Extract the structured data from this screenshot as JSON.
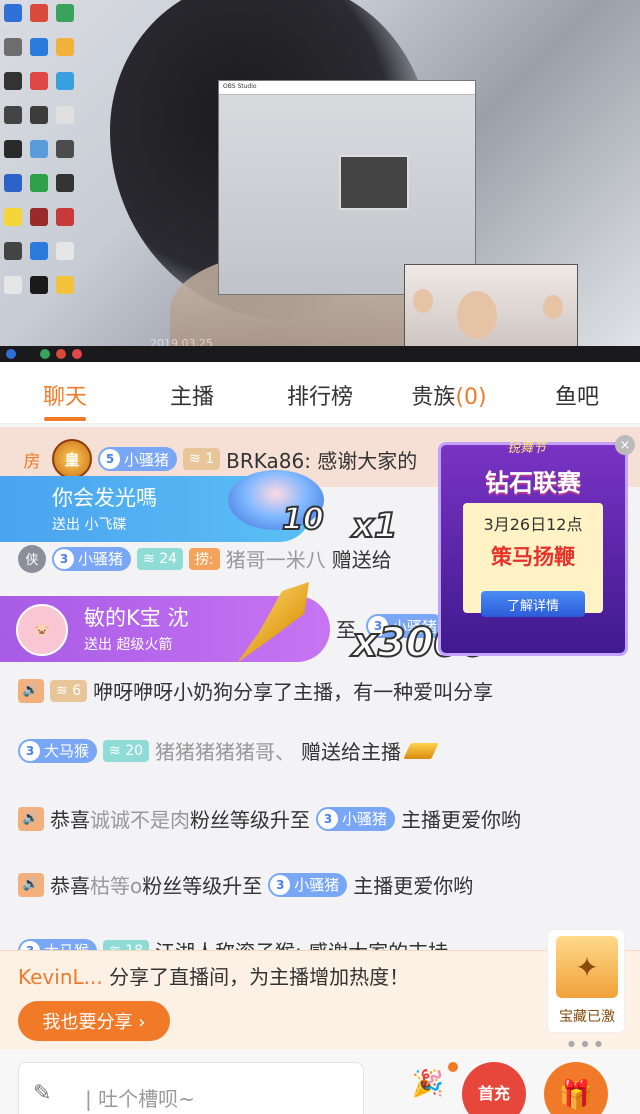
{
  "video": {
    "date_stamp": "2019.03.25"
  },
  "tabs": [
    {
      "label": "聊天",
      "active": true
    },
    {
      "label": "主播",
      "active": false
    },
    {
      "label": "排行榜",
      "active": false
    },
    {
      "label": "贵族",
      "count": "(0)",
      "active": false
    },
    {
      "label": "鱼吧",
      "active": false
    }
  ],
  "chat": {
    "banner": {
      "tag": "房",
      "rank": "皇",
      "fan_level": "5",
      "fan_badge": "小骚猪",
      "level": "1",
      "text": "BRKa86: 感谢大家的"
    },
    "gift1": {
      "name": "你会发光嗎",
      "action": "送出 小飞碟",
      "combo": "10",
      "multiplier": "x1"
    },
    "msg_xia": {
      "rank": "侠",
      "fan_level": "3",
      "fan_badge": "小骚猪",
      "level": "24",
      "title": "捞:",
      "user": "猪哥一米八",
      "text": "赠送给"
    },
    "gift2": {
      "name": "敏的K宝  沈",
      "action": "送出 超级火箭",
      "tail": "至",
      "multiplier": "x3000"
    },
    "msg_share": {
      "level": "6",
      "text": "咿呀咿呀小奶狗分享了主播，有一种爱叫分享"
    },
    "msg_gift3": {
      "fan_level": "3",
      "fan_badge": "大马猴",
      "level": "20",
      "user": "猪猪猪猪猪哥、",
      "text": "赠送给主播"
    },
    "msg_congrats1": {
      "prefix": "恭喜",
      "user": "诚诚不是肉",
      "middle": "粉丝等级升至",
      "fan_level": "3",
      "fan_badge": "小骚猪",
      "suffix": "主播更爱你哟"
    },
    "msg_congrats2": {
      "prefix": "恭喜",
      "user": "枯等o",
      "middle": "粉丝等级升至",
      "fan_level": "3",
      "fan_badge": "小骚猪",
      "suffix": "主播更爱你哟"
    },
    "msg_partial": {
      "text": "江湖人称滚子猴: 感谢大家的支持"
    }
  },
  "ad": {
    "tag": "锐舞节",
    "title": "钻石联赛",
    "date": "3月26日12点",
    "subtitle": "策马扬鞭",
    "button": "了解详情",
    "close": "×"
  },
  "share": {
    "user": "KevinL...",
    "text": "分享了直播间，为主播增加热度！",
    "button": "我也要分享 ›",
    "treasure_label": "宝藏已激"
  },
  "input": {
    "placeholder": "| 吐个槽呗~",
    "charge_label": "首充"
  },
  "colors": {
    "accent": "#f07a28",
    "fan_badge_blue": "#79a7f5",
    "level_green": "#8fdcd6",
    "gift_blue": "#4aa3ef",
    "gift_purple": "#a85be6"
  }
}
